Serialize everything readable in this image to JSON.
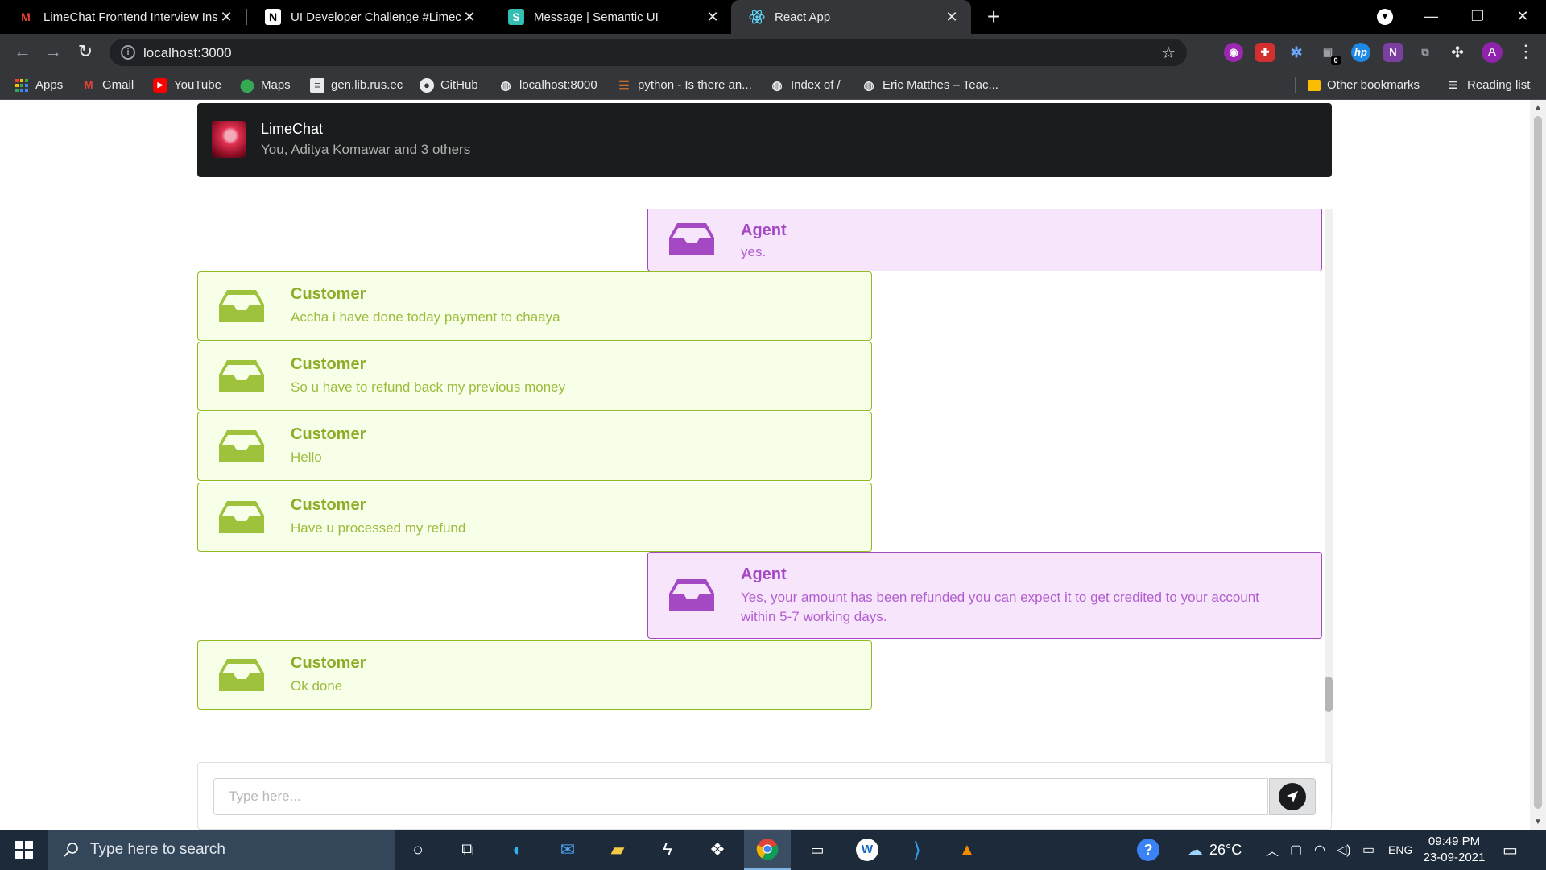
{
  "browser": {
    "tabs": [
      {
        "title": "LimeChat Frontend Interview Inst",
        "icon": "gmail-icon"
      },
      {
        "title": "UI Developer Challenge #Limech",
        "icon": "notion-icon"
      },
      {
        "title": "Message | Semantic UI",
        "icon": "semantic-ui-icon"
      },
      {
        "title": "React App",
        "icon": "react-icon"
      }
    ],
    "url": "localhost:3000",
    "bookmarks": [
      {
        "label": "Apps"
      },
      {
        "label": "Gmail"
      },
      {
        "label": "YouTube"
      },
      {
        "label": "Maps"
      },
      {
        "label": "gen.lib.rus.ec"
      },
      {
        "label": "GitHub"
      },
      {
        "label": "localhost:8000"
      },
      {
        "label": "python - Is there an..."
      },
      {
        "label": "Index of /"
      },
      {
        "label": "Eric Matthes – Teac..."
      }
    ],
    "other_bookmarks": "Other bookmarks",
    "reading_list": "Reading list",
    "profile_initial": "A",
    "extension_badge": "0"
  },
  "chat": {
    "title": "LimeChat",
    "subtitle": "You, Aditya Komawar and 3 others",
    "messages": [
      {
        "role": "agent",
        "author": "Agent",
        "text": "yes."
      },
      {
        "role": "customer",
        "author": "Customer",
        "text": "Accha i have done today payment to chaaya"
      },
      {
        "role": "customer",
        "author": "Customer",
        "text": "So u have to refund back my previous money"
      },
      {
        "role": "customer",
        "author": "Customer",
        "text": "Hello"
      },
      {
        "role": "customer",
        "author": "Customer",
        "text": "Have u processed my refund"
      },
      {
        "role": "agent",
        "author": "Agent",
        "text": "Yes, your amount has been refunded you can expect it to get credited to your account within 5-7 working days."
      },
      {
        "role": "customer",
        "author": "Customer",
        "text": "Ok done"
      }
    ],
    "input_placeholder": "Type here...",
    "input_value": ""
  },
  "colors": {
    "customer_accent": "#8fab27",
    "customer_bg": "#f8ffe8",
    "agent_accent": "#a548c4",
    "agent_bg": "#f7e6fb"
  },
  "taskbar": {
    "search_placeholder": "Type here to search",
    "temperature": "26°C",
    "language": "ENG",
    "time": "09:49 PM",
    "date": "23-09-2021"
  }
}
